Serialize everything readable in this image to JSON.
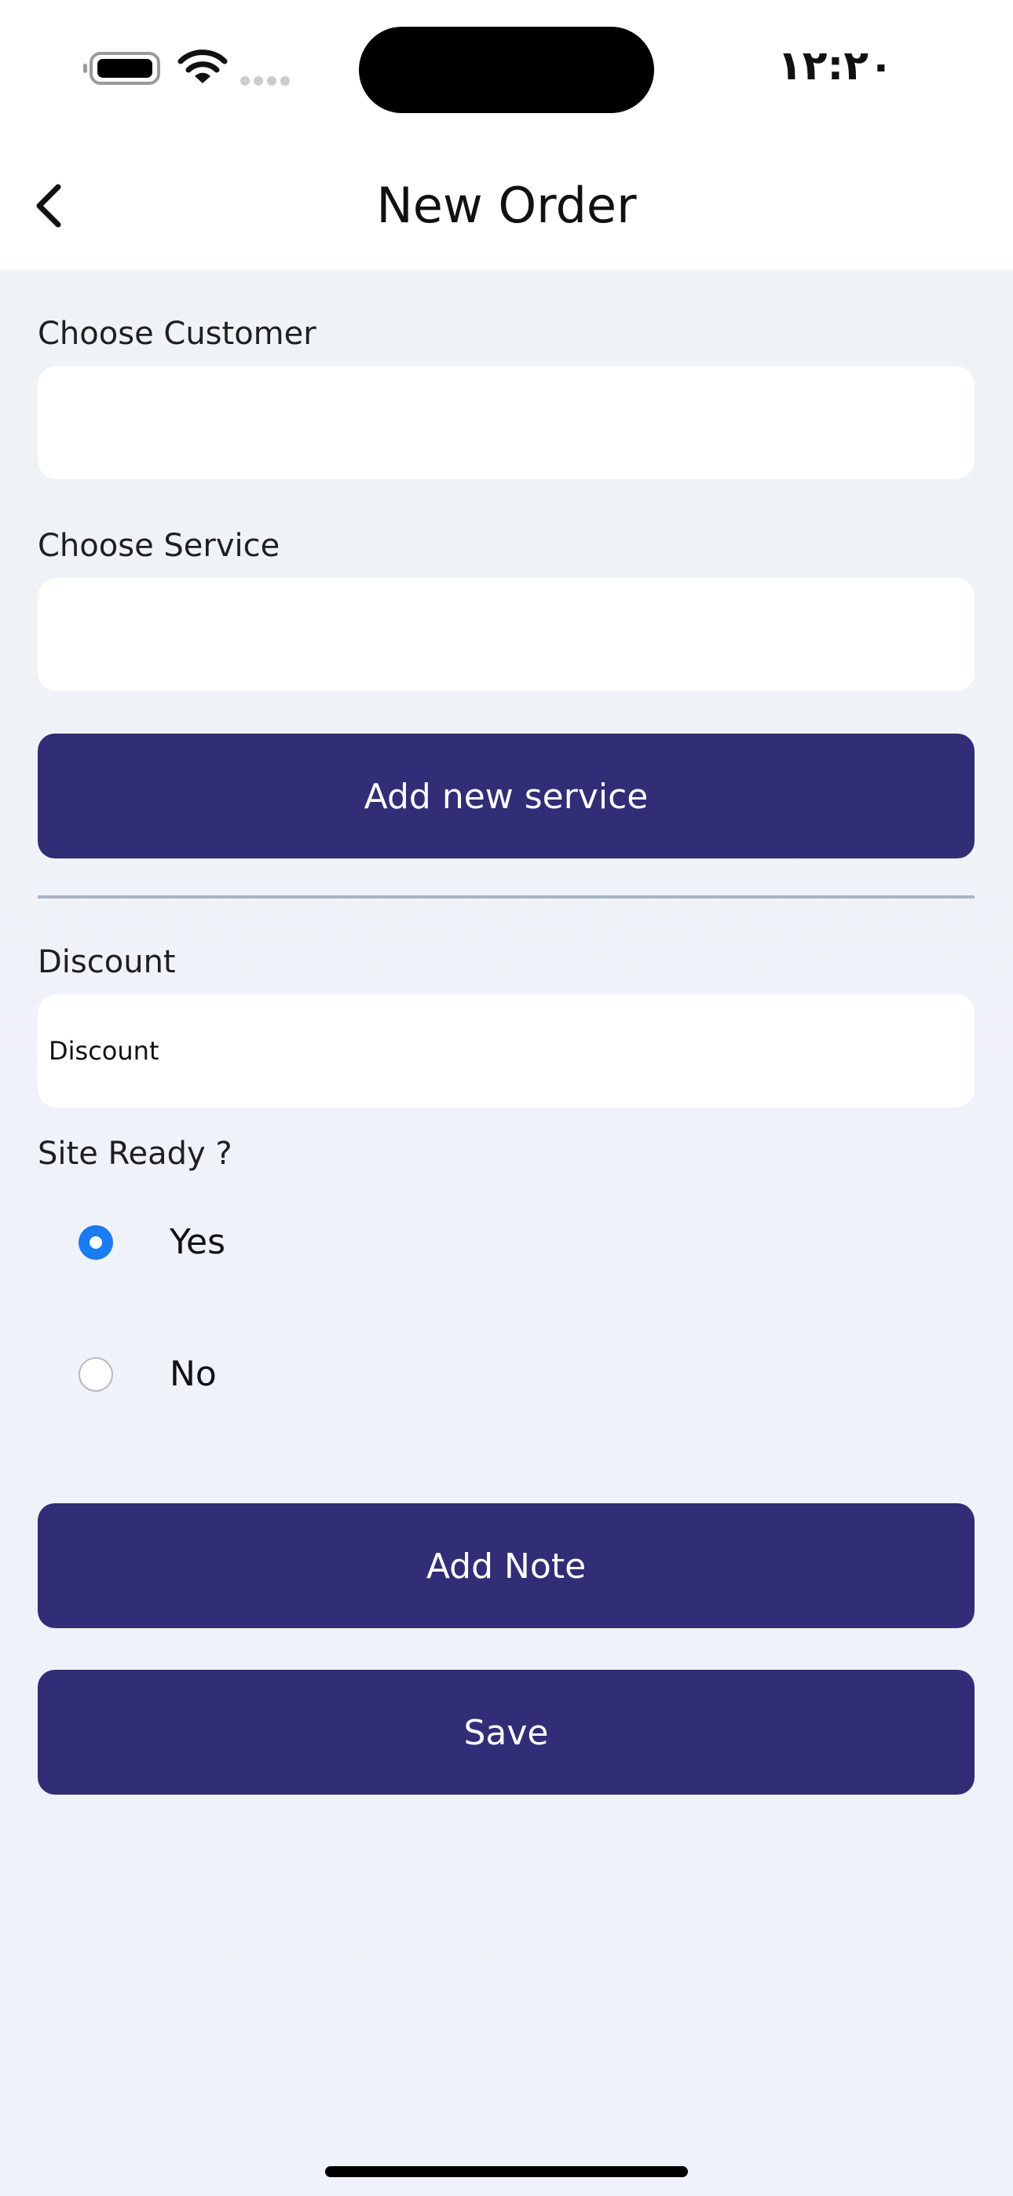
{
  "status_bar": {
    "time": "۱۲:۲۰",
    "icons": [
      "battery-icon",
      "wifi-icon",
      "cellular-signal-icon"
    ]
  },
  "header": {
    "title": "New Order",
    "back_icon": "chevron-left-icon"
  },
  "form": {
    "customer": {
      "label": "Choose Customer",
      "value": ""
    },
    "service": {
      "label": "Choose Service",
      "value": ""
    },
    "add_service_button": "Add new service",
    "discount": {
      "label": "Discount",
      "placeholder": "Discount",
      "value": ""
    },
    "site_ready": {
      "label": "Site Ready ?",
      "options": [
        {
          "label": "Yes",
          "selected": true
        },
        {
          "label": "No",
          "selected": false
        }
      ]
    },
    "add_note_button": "Add Note",
    "save_button": "Save"
  },
  "colors": {
    "primary_button": "#312d76",
    "radio_selected": "#1a7bf2",
    "background": "#eff2f9",
    "divider": "#a9b4c2"
  }
}
